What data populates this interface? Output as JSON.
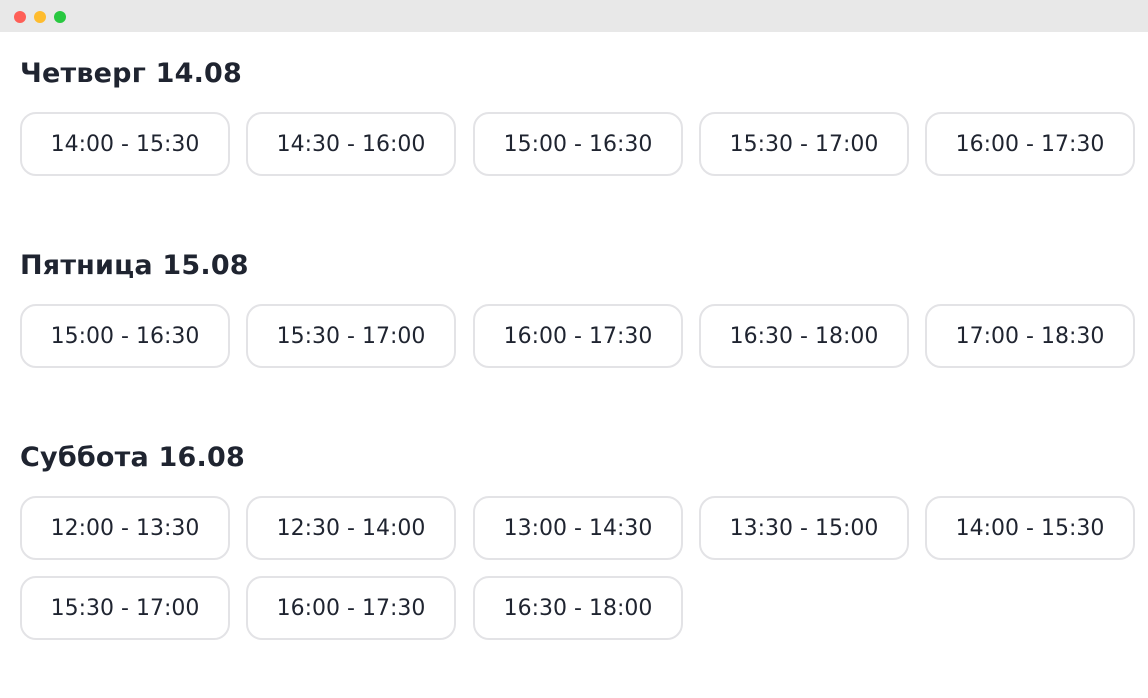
{
  "window": {
    "buttons": [
      "close",
      "minimize",
      "maximize"
    ]
  },
  "days": [
    {
      "title": "Четверг 14.08",
      "slots": [
        "14:00 - 15:30",
        "14:30 - 16:00",
        "15:00 - 16:30",
        "15:30 - 17:00",
        "16:00 - 17:30"
      ]
    },
    {
      "title": "Пятница 15.08",
      "slots": [
        "15:00 - 16:30",
        "15:30 - 17:00",
        "16:00 - 17:30",
        "16:30 - 18:00",
        "17:00 - 18:30"
      ]
    },
    {
      "title": "Суббота 16.08",
      "slots": [
        "12:00 - 13:30",
        "12:30 - 14:00",
        "13:00 - 14:30",
        "13:30 - 15:00",
        "14:00 - 15:30",
        "15:30 - 17:00",
        "16:00 - 17:30",
        "16:30 - 18:00"
      ]
    }
  ],
  "colors": {
    "text": "#1f2430",
    "slot_border": "#e3e3e6",
    "titlebar": "#e8e8e8",
    "close": "#fe5f57",
    "minimize": "#febc2e",
    "maximize": "#28c840"
  }
}
